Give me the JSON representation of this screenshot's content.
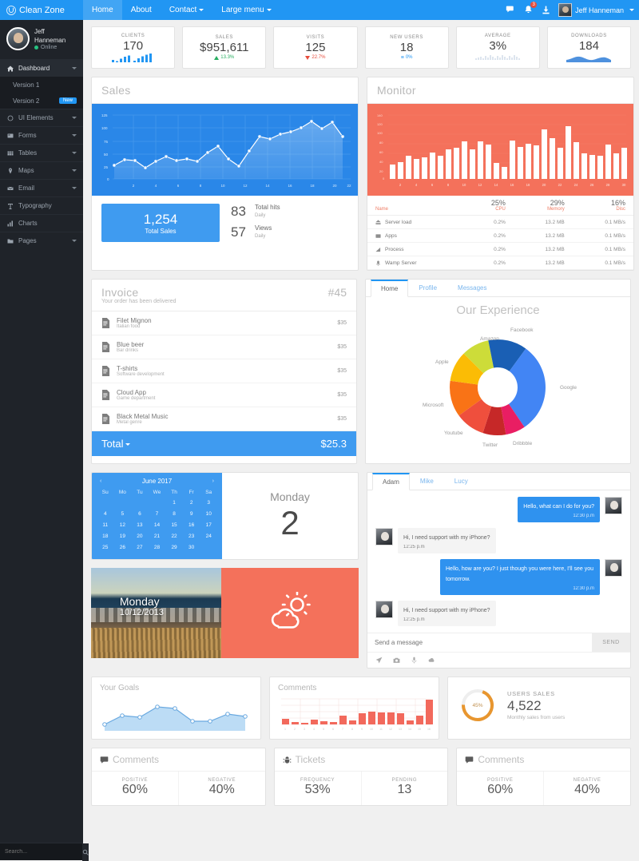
{
  "topnav": {
    "brand": "Clean Zone",
    "links": [
      {
        "label": "Home",
        "active": true,
        "caret": false
      },
      {
        "label": "About",
        "active": false,
        "caret": false
      },
      {
        "label": "Contact",
        "active": false,
        "caret": true
      },
      {
        "label": "Large menu",
        "active": false,
        "caret": true
      }
    ],
    "icons": [
      "comments-icon",
      "bell-icon",
      "download-icon"
    ],
    "notification_count": "3",
    "user": "Jeff Hanneman"
  },
  "sidebar": {
    "user": {
      "name": "Jeff Hanneman",
      "status": "Online"
    },
    "items": [
      {
        "label": "Dashboard",
        "icon": "home-icon",
        "caret": true,
        "active": true
      },
      {
        "label": "UI Elements",
        "icon": "circle-icon",
        "caret": true,
        "active": false
      },
      {
        "label": "Forms",
        "icon": "form-icon",
        "caret": true,
        "active": false
      },
      {
        "label": "Tables",
        "icon": "table-icon",
        "caret": true,
        "active": false
      },
      {
        "label": "Maps",
        "icon": "pin-icon",
        "caret": true,
        "active": false
      },
      {
        "label": "Email",
        "icon": "envelope-icon",
        "caret": true,
        "active": false
      },
      {
        "label": "Typography",
        "icon": "text-icon",
        "caret": false,
        "active": false
      },
      {
        "label": "Charts",
        "icon": "bar-chart-icon",
        "caret": false,
        "active": false
      },
      {
        "label": "Pages",
        "icon": "folder-icon",
        "caret": true,
        "active": false
      }
    ],
    "submenu": [
      {
        "label": "Version 1",
        "badge": ""
      },
      {
        "label": "Version 2",
        "badge": "New"
      }
    ],
    "search_placeholder": "Search..."
  },
  "stats": [
    {
      "label": "CLIENTS",
      "value": "170",
      "spark": "bars",
      "delta": "",
      "dir": ""
    },
    {
      "label": "SALES",
      "value": "$951,611",
      "spark": "",
      "delta": "13.3%",
      "dir": "up"
    },
    {
      "label": "VISITS",
      "value": "125",
      "spark": "",
      "delta": "22.7%",
      "dir": "down"
    },
    {
      "label": "NEW USERS",
      "value": "18",
      "spark": "",
      "delta": "0%",
      "dir": "flat"
    },
    {
      "label": "AVERAGE",
      "value": "3%",
      "spark": "needles",
      "delta": "",
      "dir": ""
    },
    {
      "label": "DOWNLOADS",
      "value": "184",
      "spark": "area",
      "delta": "",
      "dir": ""
    }
  ],
  "sales": {
    "title": "Sales",
    "total_sales_value": "1,254",
    "total_sales_label": "Total Sales",
    "hits": [
      {
        "num": "83",
        "label": "Total hits",
        "sub": "Daily"
      },
      {
        "num": "57",
        "label": "Views",
        "sub": "Daily"
      }
    ]
  },
  "monitor": {
    "title": "Monitor",
    "columns": [
      "Name",
      "CPU",
      "Memory",
      "Disc"
    ],
    "col_percents": [
      "",
      "25%",
      "29%",
      "16%"
    ],
    "rows": [
      {
        "name": "Server load",
        "icon": "server-icon",
        "cpu": "0.2%",
        "memory": "13.2 MB",
        "disc": "0.1 MB/s"
      },
      {
        "name": "Apps",
        "icon": "apps-icon",
        "cpu": "0.2%",
        "memory": "13.2 MB",
        "disc": "0.1 MB/s"
      },
      {
        "name": "Process",
        "icon": "process-icon",
        "cpu": "0.2%",
        "memory": "13.2 MB",
        "disc": "0.1 MB/s"
      },
      {
        "name": "Wamp Server",
        "icon": "wamp-icon",
        "cpu": "0.2%",
        "memory": "13.2 MB",
        "disc": "0.1 MB/s"
      }
    ]
  },
  "invoice": {
    "title": "Invoice",
    "subtitle": "Your order has been delivered",
    "number": "#45",
    "items": [
      {
        "name": "Filet Mignon",
        "desc": "Italian food",
        "price": "$35"
      },
      {
        "name": "Blue beer",
        "desc": "Bar drinks",
        "price": "$35"
      },
      {
        "name": "T-shirts",
        "desc": "Software development",
        "price": "$35"
      },
      {
        "name": "Cloud App",
        "desc": "Game department",
        "price": "$35"
      },
      {
        "name": "Black Metal Music",
        "desc": "Metal genre",
        "price": "$35"
      }
    ],
    "total_label": "Total",
    "total_value": "$25.3"
  },
  "experience": {
    "tabs": [
      {
        "label": "Home",
        "active": true
      },
      {
        "label": "Profile",
        "active": false
      },
      {
        "label": "Messages",
        "active": false
      }
    ],
    "title": "Our Experience"
  },
  "calendar": {
    "month": "June 2017",
    "prev": "‹",
    "next": "›",
    "dow": [
      "Su",
      "Mo",
      "Tu",
      "We",
      "Th",
      "Fr",
      "Sa"
    ],
    "lead_blanks": 4,
    "days": [
      1,
      2,
      3,
      4,
      5,
      6,
      7,
      8,
      9,
      10,
      11,
      12,
      13,
      14,
      15,
      16,
      17,
      18,
      19,
      20,
      21,
      22,
      23,
      24,
      25,
      26,
      27,
      28,
      29,
      30
    ],
    "day_name": "Monday",
    "day_number": "2"
  },
  "chat": {
    "tabs": [
      {
        "label": "Adam",
        "active": true
      },
      {
        "label": "Mike",
        "active": false
      },
      {
        "label": "Lucy",
        "active": false
      }
    ],
    "messages": [
      {
        "dir": "out",
        "text": "Hello, what can I do for you?",
        "time": "12:30 p.m"
      },
      {
        "dir": "in",
        "text": "Hi, I need support with my iPhone?",
        "time": "12:25 p.m"
      },
      {
        "dir": "out",
        "text": "Hello, how are you? I just though you were here, I'll see you tomorrow.",
        "time": "12:30 p.m"
      },
      {
        "dir": "in",
        "text": "Hi, I need support with my iPhone?",
        "time": "12:25 p.m"
      }
    ],
    "input_placeholder": "Send a message",
    "send_label": "SEND",
    "tools": [
      "location-icon",
      "camera-icon",
      "microphone-icon",
      "cloud-icon"
    ]
  },
  "weather": {
    "day": "Monday",
    "date": "10/12/2013",
    "icon": "sun-cloud-icon"
  },
  "widgets": {
    "goals_title": "Your Goals",
    "comments_title": "Comments",
    "users": {
      "label": "USERS SALES",
      "value": "4,522",
      "sub": "Monthly sales from users",
      "gauge_text": "45%",
      "gauge_percent": 45
    }
  },
  "kpi_cards": [
    {
      "title": "Comments",
      "icon": "comment-icon",
      "cells": [
        {
          "label": "POSITIVE",
          "value": "60%"
        },
        {
          "label": "NEGATIVE",
          "value": "40%"
        }
      ]
    },
    {
      "title": "Tickets",
      "icon": "bug-icon",
      "cells": [
        {
          "label": "FREQUENCY",
          "value": "53%"
        },
        {
          "label": "PENDING",
          "value": "13"
        }
      ]
    },
    {
      "title": "Comments",
      "icon": "comment-icon",
      "cells": [
        {
          "label": "POSITIVE",
          "value": "60%"
        },
        {
          "label": "NEGATIVE",
          "value": "40%"
        }
      ]
    }
  ],
  "colors": {
    "primary": "#2196f3",
    "sidebar": "#1f2329",
    "orange": "#f4715b",
    "green": "#27ae60",
    "red": "#e74c3c"
  },
  "chart_data": [
    {
      "type": "line",
      "name": "sales-line-chart",
      "title": "Sales",
      "x": [
        1,
        2,
        3,
        4,
        5,
        6,
        7,
        8,
        9,
        10,
        11,
        12,
        13,
        14,
        15,
        16,
        17,
        18,
        19,
        20,
        21,
        22,
        23
      ],
      "values": [
        27,
        38,
        36,
        22,
        35,
        45,
        38,
        41,
        35,
        52,
        65,
        40,
        26,
        54,
        82,
        78,
        88,
        92,
        100,
        112,
        97,
        110,
        83
      ],
      "xlabel": "",
      "ylabel": "",
      "xticks": [
        2,
        4,
        6,
        8,
        10,
        12,
        14,
        16,
        18,
        20,
        22
      ],
      "yticks": [
        0,
        25,
        50,
        75,
        100,
        125
      ],
      "ylim": [
        0,
        125
      ],
      "grid": true
    },
    {
      "type": "bar",
      "name": "monitor-bar-chart",
      "title": "Monitor",
      "categories": [
        1,
        2,
        3,
        4,
        5,
        6,
        7,
        8,
        9,
        10,
        11,
        12,
        13,
        14,
        15,
        16,
        17,
        18,
        19,
        20,
        21,
        22,
        23,
        24,
        25,
        26,
        27,
        28,
        29,
        30
      ],
      "values": [
        30,
        35,
        48,
        42,
        45,
        55,
        48,
        62,
        65,
        78,
        62,
        78,
        72,
        40,
        33,
        80,
        68,
        75,
        72,
        105,
        85,
        70,
        112,
        82,
        62,
        60,
        58,
        78,
        62,
        72
      ],
      "xticks": [
        2,
        4,
        6,
        8,
        10,
        12,
        14,
        16,
        18,
        20,
        22,
        24,
        26,
        28,
        30
      ],
      "yticks": [
        0,
        20,
        40,
        60,
        80,
        100,
        120,
        140
      ],
      "ylim": [
        0,
        140
      ],
      "grid": false
    },
    {
      "type": "pie",
      "name": "experience-donut-chart",
      "title": "Our Experience",
      "labels": [
        "Google",
        "Dribbble",
        "Twitter",
        "Youtube",
        "Microsoft",
        "Apple",
        "Amazon",
        "Facebook"
      ],
      "values": [
        30,
        7,
        8,
        9,
        11,
        12,
        9,
        4
      ],
      "colors": [
        "#4285f4",
        "#e91e63",
        "#c62828",
        "#ef4f3d",
        "#f97316",
        "#fbbc05",
        "#cddc39",
        "#1a5fb4"
      ]
    },
    {
      "type": "area",
      "name": "your-goals-chart",
      "title": "Your Goals",
      "x": [
        1,
        2,
        3,
        4,
        5,
        6,
        7,
        8,
        9
      ],
      "values": [
        20,
        42,
        38,
        62,
        58,
        30,
        30,
        44,
        40
      ],
      "ylim": [
        0,
        70
      ]
    },
    {
      "type": "bar",
      "name": "comments-bar-chart",
      "title": "Comments",
      "categories": [
        1,
        2,
        3,
        4,
        5,
        6,
        7,
        8,
        9,
        10,
        11,
        12,
        13,
        14,
        15,
        16
      ],
      "values": [
        22,
        10,
        8,
        20,
        14,
        10,
        34,
        18,
        42,
        48,
        46,
        44,
        42,
        18,
        34,
        100
      ],
      "ylim": [
        0,
        100
      ],
      "grid": true
    },
    {
      "type": "pie",
      "name": "users-sales-gauge",
      "title": "USERS SALES",
      "labels": [
        "45%"
      ],
      "values": [
        45
      ],
      "colors": [
        "#e8962f"
      ]
    },
    {
      "type": "bar",
      "name": "clients-sparkline",
      "categories": [
        1,
        2,
        3,
        4,
        5,
        6,
        7,
        8,
        9,
        10
      ],
      "values": [
        18,
        10,
        30,
        46,
        58,
        12,
        34,
        52,
        70,
        88
      ]
    },
    {
      "type": "line",
      "name": "downloads-sparkline",
      "x": [
        1,
        2,
        3,
        4,
        5,
        6,
        7,
        8,
        9,
        10
      ],
      "values": [
        30,
        38,
        62,
        48,
        32,
        28,
        34,
        50,
        44,
        30
      ]
    }
  ]
}
